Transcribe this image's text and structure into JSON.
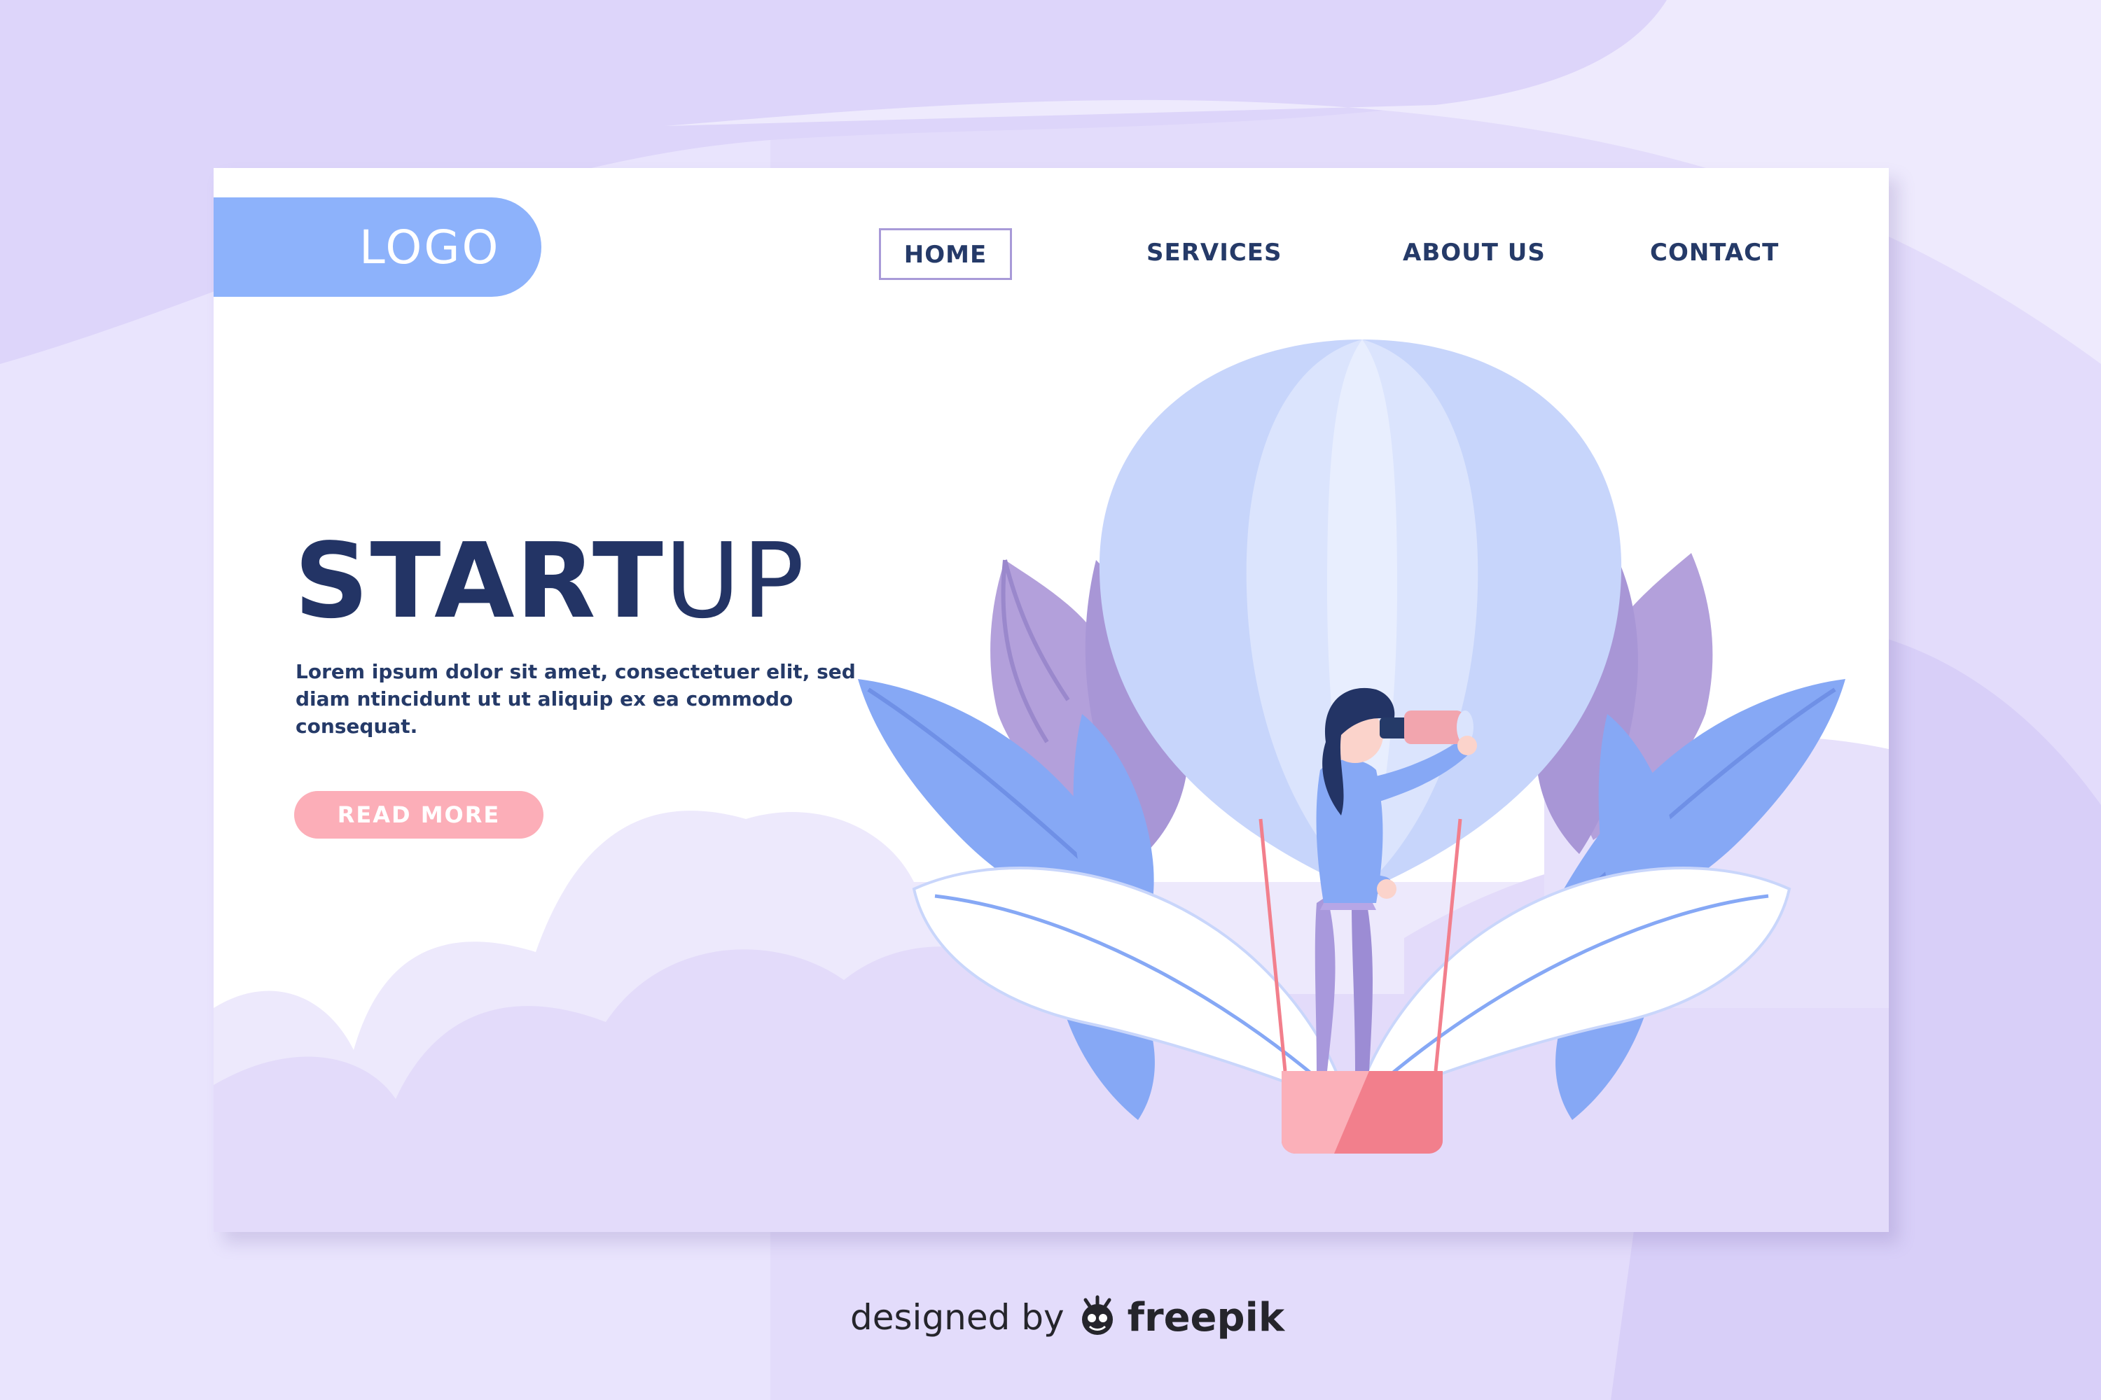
{
  "header": {
    "logo": "LOGO",
    "nav": [
      {
        "label": "HOME",
        "active": true
      },
      {
        "label": "SERVICES",
        "active": false
      },
      {
        "label": "ABOUT US",
        "active": false
      },
      {
        "label": "CONTACT",
        "active": false
      }
    ]
  },
  "hero": {
    "title_bold": "START",
    "title_light": "UP",
    "description": "Lorem ipsum dolor sit amet, consectetuer elit, sed diam ntincidunt ut  ut aliquip ex ea commodo consequat.",
    "cta_label": "READ MORE"
  },
  "footer": {
    "credit_prefix": "designed by",
    "credit_brand": "freepik"
  },
  "colors": {
    "page_background": "#e3dcfb",
    "logo_background": "#8db2fb",
    "text_dark": "#253a68",
    "cta_background": "#fcaeb8",
    "balloon": "#c7d5fb",
    "basket": "#f27f8c",
    "leaves_blue": "#86a8f5",
    "leaves_purple": "#b3a0db"
  },
  "icons": {
    "illustration": "hot-air-balloon-illustration",
    "credit": "freepik-logo-icon"
  }
}
